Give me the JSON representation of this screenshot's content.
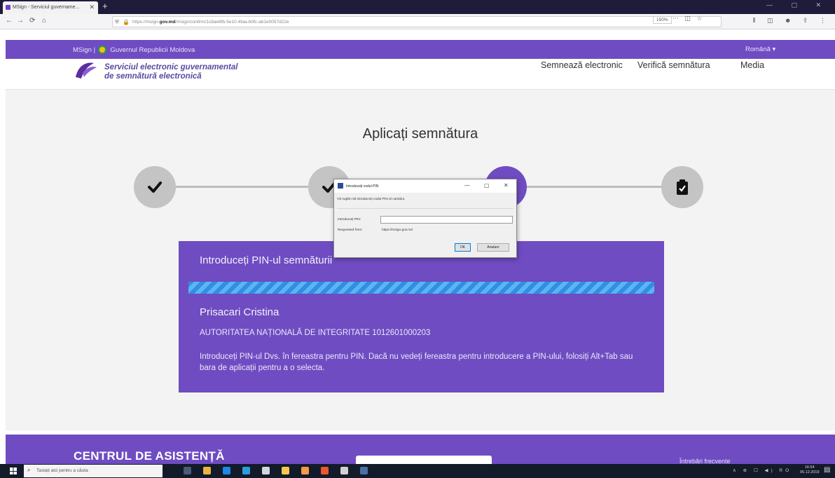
{
  "browser": {
    "tab_title": "MSign - Serviciul guvername...",
    "tab_close": "✕",
    "new_tab": "+",
    "window_controls": "—  ▢  ✕",
    "nav_back": "←",
    "nav_forward": "→",
    "nav_reload": "⟳",
    "nav_home": "⌂",
    "url_prefix": "https://msign.",
    "url_domain": "gov.md",
    "url_path": "/#/sign/confirm/1c8ae6fb-5e10-4faa-b0fc-ab1e0057d22e",
    "zoom": "150%",
    "url_icons": "⋯ ◫ ☆",
    "toolbar_icons": "⫴ ◫ ☻ ⇪ ⋮"
  },
  "govbar": {
    "brand": "MSign |",
    "government": "Guvernul Republicii Moldova",
    "language": "Română ▾"
  },
  "header": {
    "service_line1": "Serviciul electronic guvernamental",
    "service_line2": "de semnătură electronică",
    "nav_sign": "Semnează electronic",
    "nav_verify": "Verifică semnătura",
    "nav_media": "Media"
  },
  "main": {
    "title": "Aplicați semnătura"
  },
  "steps": [
    {
      "state": "done",
      "icon": "check-icon"
    },
    {
      "state": "done",
      "icon": "check-icon"
    },
    {
      "state": "active",
      "icon": "document-sign-icon"
    },
    {
      "state": "pending",
      "icon": "clipboard-check-icon"
    }
  ],
  "card": {
    "heading": "Introduceți PIN-ul semnăturii",
    "progress_state": "indeterminate",
    "signer_name": "Prisacari Cristina",
    "organization": "AUTORITATEA NAȚIONALĂ DE INTEGRITATE 1012601000203",
    "instructions": "Introduceți PIN-ul Dvs. în fereastra pentru PIN. Dacă nu vedeți fereastra pentru introducere a PIN-ului, folosiți Alt+Tab sau bara de aplicații pentru a o selecta."
  },
  "dialog": {
    "title": "Introduceți codul PIN",
    "minimize": "—",
    "maximize": "▢",
    "close": "✕",
    "message": "Vă rugăm să introduceți codul PIN al cardului.",
    "pin_label": "Introduceți PIN:",
    "pin_value": "",
    "requested_label": "Requested from:",
    "requested_value": "https://msign.gov.md",
    "ok": "OK",
    "cancel": "Anulare"
  },
  "footer": {
    "heading": "CENTRUL DE ASISTENȚĂ",
    "link": "Întrebări frecvente"
  },
  "taskbar": {
    "search_placeholder": "Tastați aici pentru a căuta",
    "tray": "∧ ⊕ ☐ ◀) RO",
    "time": "16:54",
    "date": "05.12.2019",
    "notifications": "▤"
  },
  "colors": {
    "brand_purple": "#6f4cc2",
    "progress_blue": "#2f8fe0",
    "step_gray": "#c4c4c4"
  }
}
